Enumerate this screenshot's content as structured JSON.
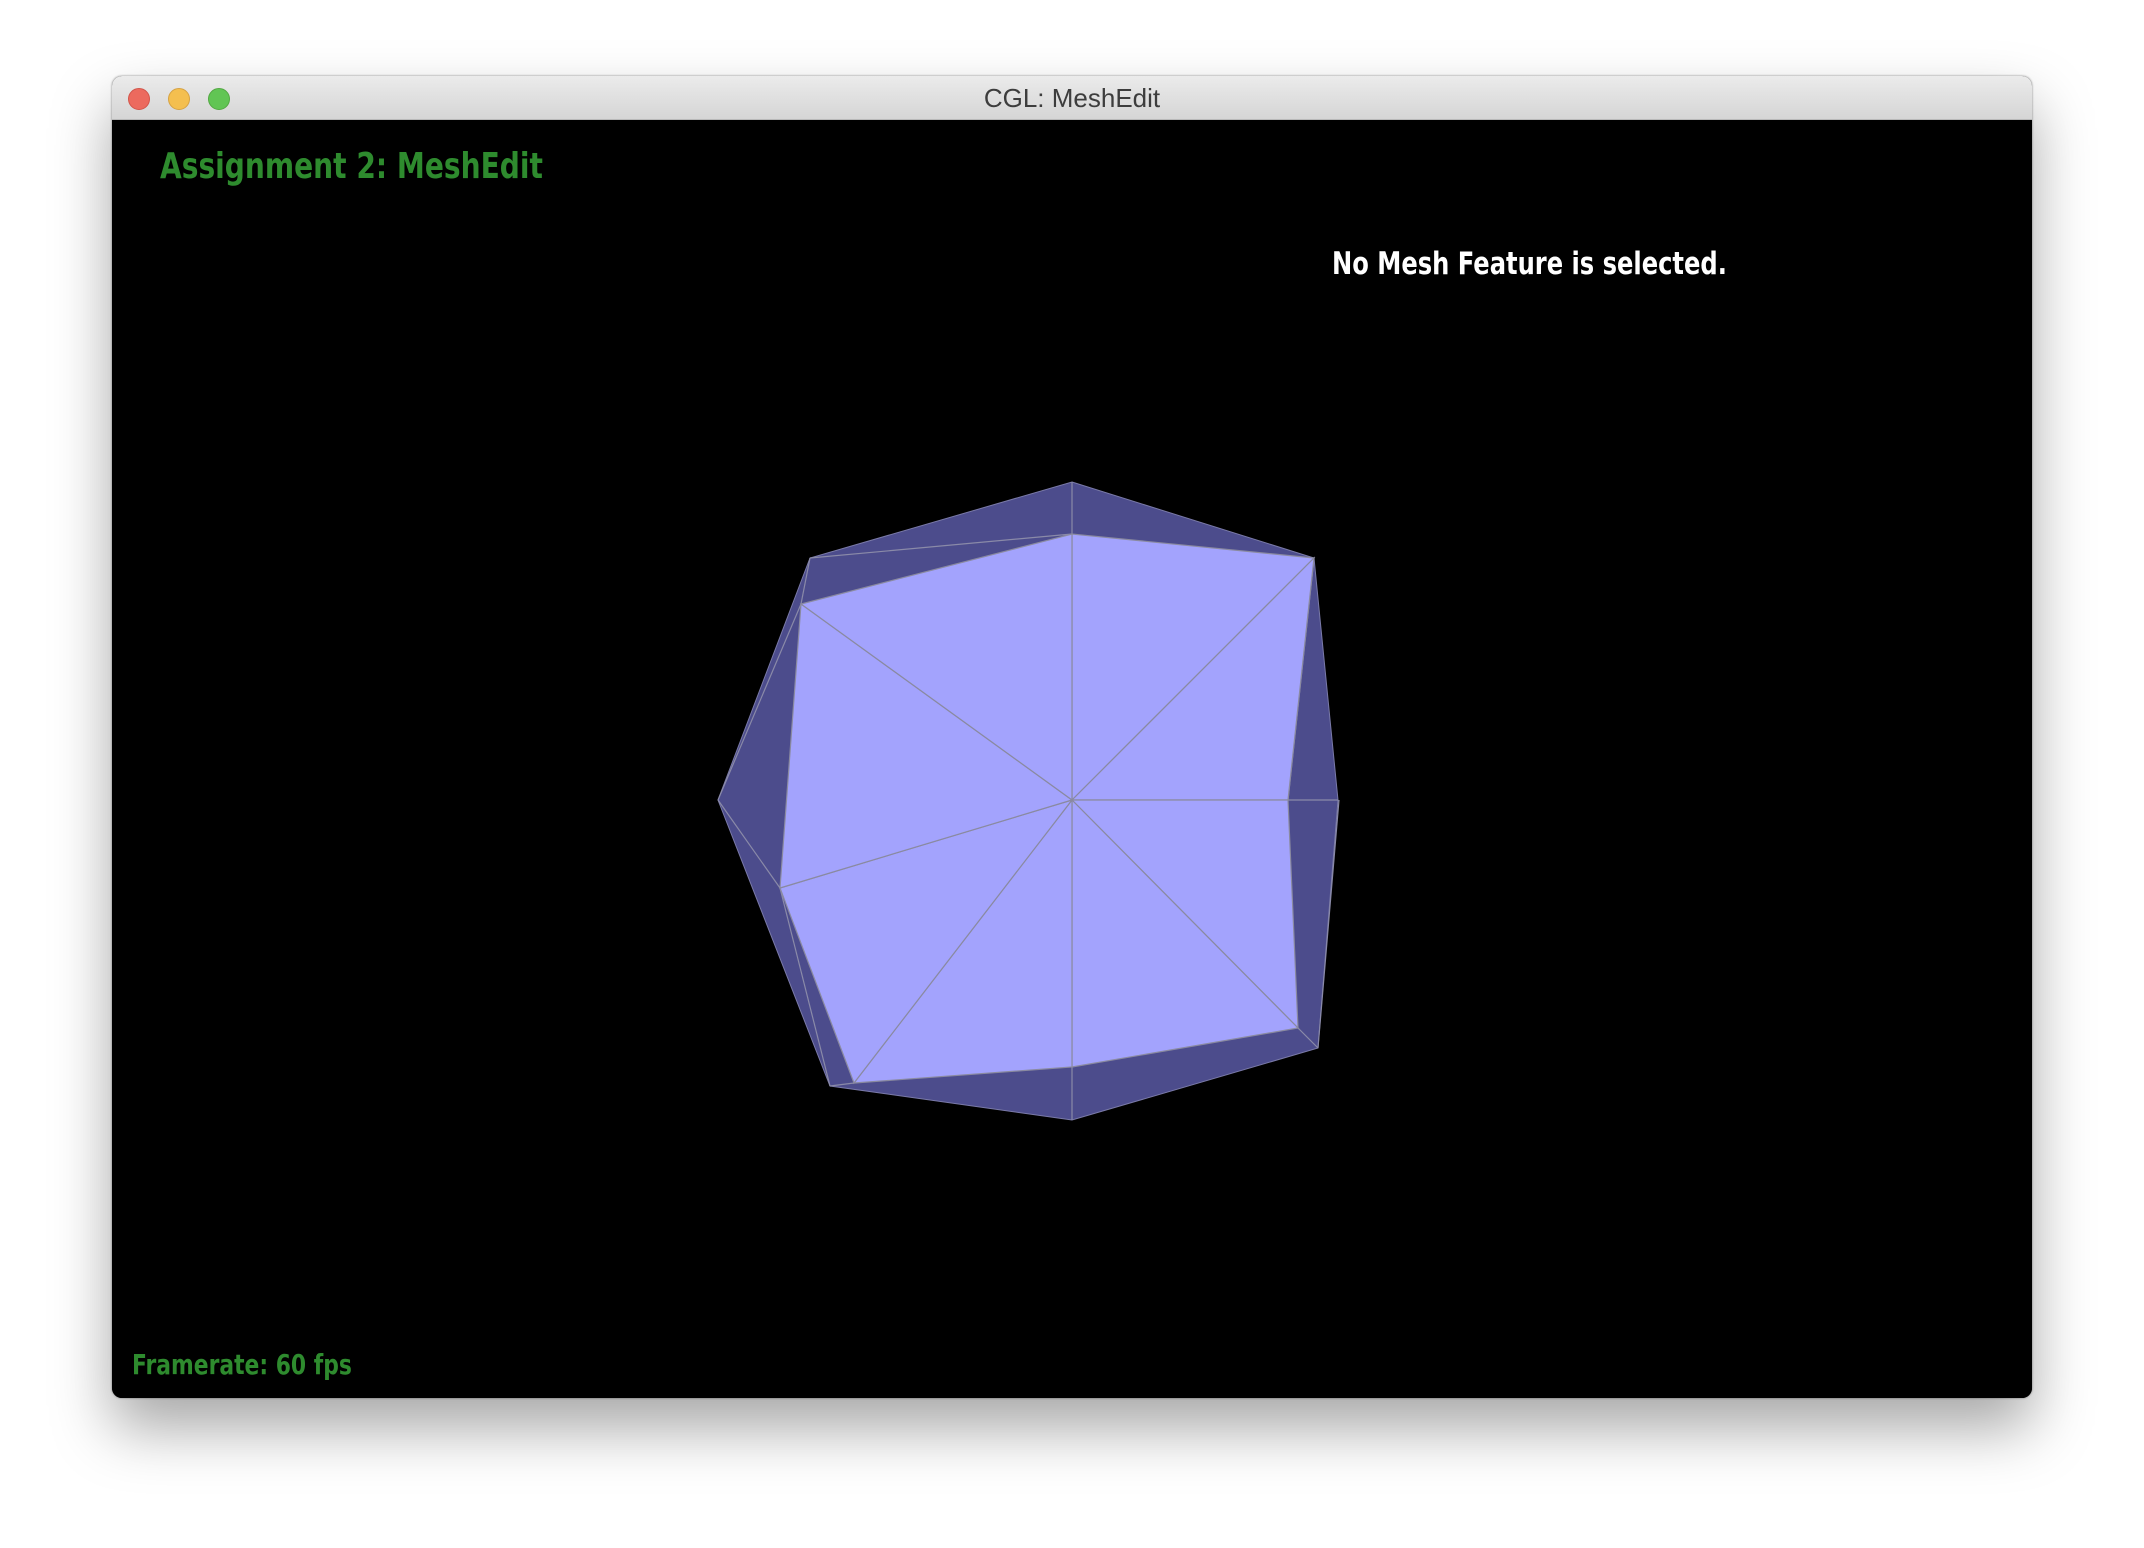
{
  "window": {
    "title": "CGL: MeshEdit"
  },
  "hud": {
    "assignment_title": "Assignment 2: MeshEdit",
    "selection_status": "No Mesh Feature is selected.",
    "framerate": "Framerate: 60 fps"
  },
  "colors": {
    "background": "#000000",
    "mesh_front": "#a3a3fd",
    "mesh_side": "#4c4c8c",
    "mesh_edge": "#8a8aa0",
    "hud_green": "#2e8b2e",
    "hud_white": "#ffffff"
  }
}
